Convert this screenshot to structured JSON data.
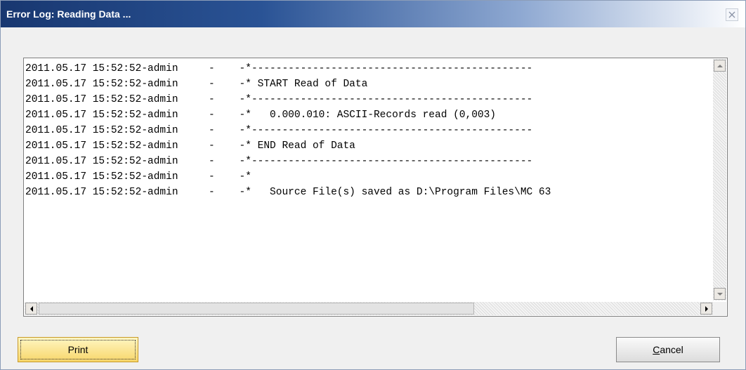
{
  "window": {
    "title": "Error Log: Reading Data ..."
  },
  "log": {
    "lines": [
      "2011.05.17 15:52:52-admin     -    -*----------------------------------------------",
      "2011.05.17 15:52:52-admin     -    -* START Read of Data",
      "2011.05.17 15:52:52-admin     -    -*----------------------------------------------",
      "2011.05.17 15:52:52-admin     -    -*   0.000.010: ASCII-Records read (0,003)",
      "2011.05.17 15:52:52-admin     -    -*----------------------------------------------",
      "2011.05.17 15:52:52-admin     -    -* END Read of Data",
      "2011.05.17 15:52:52-admin     -    -*----------------------------------------------",
      "2011.05.17 15:52:52-admin     -    -*",
      "2011.05.17 15:52:52-admin     -    -*   Source File(s) saved as D:\\Program Files\\MC 63"
    ]
  },
  "buttons": {
    "print_label": "Print",
    "cancel_label_first": "C",
    "cancel_label_rest": "ancel"
  },
  "icons": {
    "close": "close-icon",
    "scroll_up": "arrow-up-icon",
    "scroll_down": "arrow-down-icon",
    "scroll_left": "arrow-left-icon",
    "scroll_right": "arrow-right-icon"
  },
  "colors": {
    "title_start": "#183770",
    "print_button": "#f7d66a"
  }
}
